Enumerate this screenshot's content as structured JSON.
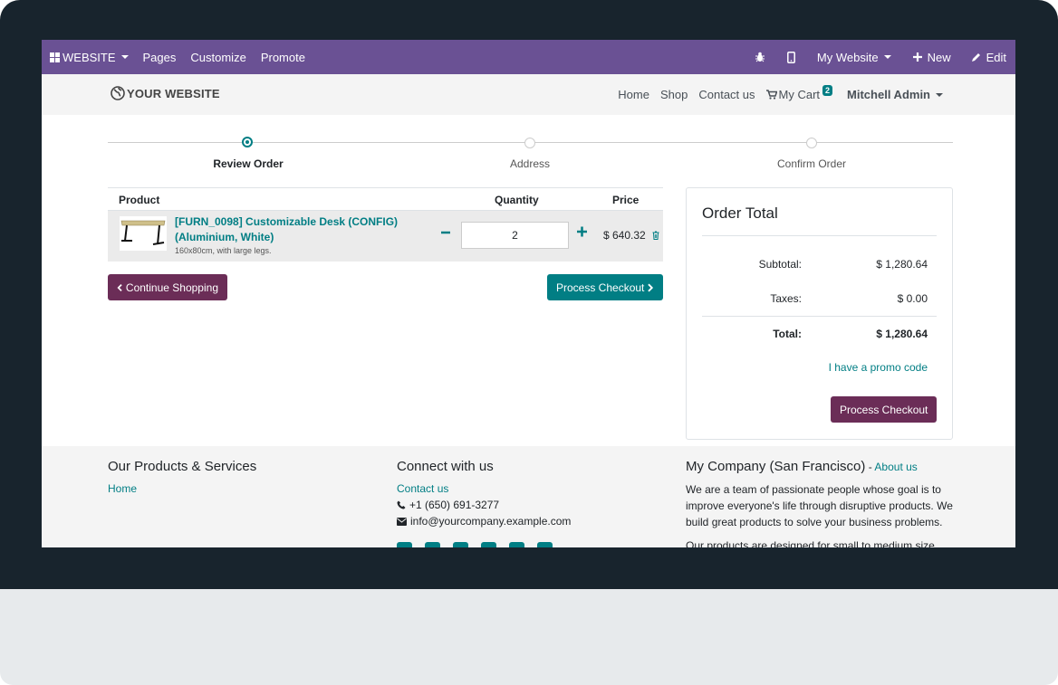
{
  "topbar": {
    "website_menu": "WEBSITE",
    "pages": "Pages",
    "customize": "Customize",
    "promote": "Promote",
    "my_website": "My Website",
    "new": "New",
    "edit": "Edit"
  },
  "header": {
    "logo_text": "YOUR WEBSITE",
    "nav": [
      "Home",
      "Shop",
      "Contact us"
    ],
    "cart_label": "My Cart",
    "cart_count": "2",
    "user": "Mitchell Admin"
  },
  "wizard": {
    "steps": [
      "Review Order",
      "Address",
      "Confirm Order"
    ],
    "active": 0
  },
  "cart": {
    "headers": {
      "product": "Product",
      "quantity": "Quantity",
      "price": "Price"
    },
    "item": {
      "name": "[FURN_0098] Customizable Desk (CONFIG) (Aluminium, White)",
      "description": "160x80cm, with large legs.",
      "quantity": "2",
      "price": "$ 640.32"
    },
    "continue_label": "Continue Shopping",
    "process_label": "Process Checkout"
  },
  "order_total": {
    "title": "Order Total",
    "subtotal_label": "Subtotal:",
    "subtotal": "$ 1,280.64",
    "taxes_label": "Taxes:",
    "taxes": "$ 0.00",
    "total_label": "Total:",
    "total": "$ 1,280.64",
    "promo": "I have a promo code",
    "process_label": "Process Checkout"
  },
  "footer": {
    "col1": {
      "title": "Our Products & Services",
      "link": "Home"
    },
    "col2": {
      "title": "Connect with us",
      "contact": "Contact us",
      "phone": "+1 (650) 691-3277",
      "email": "info@yourcompany.example.com"
    },
    "col3": {
      "title": "My Company (San Francisco)",
      "sep": " - ",
      "about_link": "About us",
      "text": "We are a team of passionate people whose goal is to improve everyone's life through disruptive products. We build great products to solve your business problems.",
      "more": "Our products are designed for small to medium size"
    }
  },
  "colors": {
    "topbar": "#6a5194",
    "teal": "#017e84",
    "plum": "#6b2d57"
  }
}
